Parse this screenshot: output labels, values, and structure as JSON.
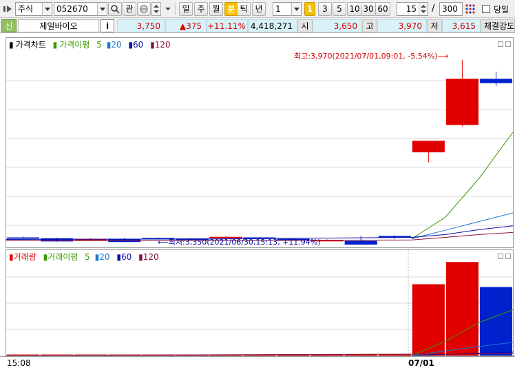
{
  "toolbar": {
    "market_type": "주식",
    "stock_code": "052670",
    "watch_label": "관",
    "period_tabs": [
      "일",
      "주",
      "월",
      "분",
      "틱",
      "년"
    ],
    "active_period": "분",
    "interval_value": "1",
    "quick_intervals": [
      "1",
      "3",
      "5",
      "10",
      "30",
      "60"
    ],
    "active_quick_interval": "1",
    "display_count": "15",
    "separator": "/",
    "total_count": "300",
    "same_day_label": "당일"
  },
  "quote": {
    "market_badge": "신",
    "stock_name": "제일바이오",
    "info_label": "i",
    "price": "3,750",
    "change": "▲375",
    "change_rate": "+11.11%",
    "volume": "4,418,271",
    "open_label": "시",
    "open": "3,650",
    "high_label": "고",
    "high": "3,970",
    "low_label": "저",
    "low": "3,615",
    "exec_label": "체결강도"
  },
  "price_panel": {
    "legend": {
      "main": "가격차트",
      "ma_title": "가격이평",
      "ma_periods": [
        "5",
        "20",
        "60",
        "120"
      ]
    },
    "high_annotation": "최고:3,970(2021/07/01,09:01, -5.54%)⟶",
    "low_annotation": "⟵최저:3,350(2021/06/30,15:13, +11.94%)"
  },
  "volume_panel": {
    "legend": {
      "main": "거래량",
      "ma_title": "거래이평",
      "ma_periods": [
        "5",
        "20",
        "60",
        "120"
      ]
    }
  },
  "footer": {
    "time_label": "15:08",
    "date_label": "07/01"
  },
  "colors": {
    "up": "#e00000",
    "down": "#0022cc",
    "ma5": "#3a9a00",
    "ma20": "#1878d0",
    "ma60": "#0a0aa8",
    "ma120": "#8a1040",
    "grid": "#d9d9d9"
  },
  "chart_data": [
    {
      "type": "candlestick",
      "title": "가격차트",
      "series_colors": {
        "up": "#e00000",
        "down": "#0022cc"
      },
      "candles": [
        {
          "o": 3355,
          "h": 3358,
          "l": 3350,
          "c": 3352
        },
        {
          "o": 3352,
          "h": 3354,
          "l": 3340,
          "c": 3341
        },
        {
          "o": 3350,
          "h": 3352,
          "l": 3345,
          "c": 3350
        },
        {
          "o": 3350,
          "h": 3354,
          "l": 3338,
          "c": 3339
        },
        {
          "o": 3353,
          "h": 3355,
          "l": 3348,
          "c": 3351
        },
        {
          "o": 3351,
          "h": 3353,
          "l": 3346,
          "c": 3350
        },
        {
          "o": 3354,
          "h": 3358,
          "l": 3350,
          "c": 3357
        },
        {
          "o": 3355,
          "h": 3357,
          "l": 3348,
          "c": 3350
        },
        {
          "o": 3350,
          "h": 3352,
          "l": 3345,
          "c": 3348
        },
        {
          "o": 3345,
          "h": 3348,
          "l": 3342,
          "c": 3346
        },
        {
          "o": 3343,
          "h": 3360,
          "l": 3330,
          "c": 3330
        },
        {
          "o": 3360,
          "h": 3362,
          "l": 3350,
          "c": 3355
        },
        {
          "o": 3650,
          "h": 3650,
          "l": 3615,
          "c": 3690
        },
        {
          "o": 3745,
          "h": 3970,
          "l": 3740,
          "c": 3905
        },
        {
          "o": 3905,
          "h": 3930,
          "l": 3880,
          "c": 3890
        }
      ],
      "moving_averages": [
        {
          "name": "5",
          "color": "#3a9a00",
          "points": [
            [
              11.5,
              3350
            ],
            [
              12.5,
              3425
            ],
            [
              13.5,
              3560
            ],
            [
              14.5,
              3720
            ]
          ]
        },
        {
          "name": "20",
          "color": "#1878d0",
          "points": [
            [
              11.5,
              3350
            ],
            [
              12.5,
              3380
            ],
            [
              13.5,
              3410
            ],
            [
              14.5,
              3440
            ]
          ]
        },
        {
          "name": "60",
          "color": "#0a0aa8",
          "points": [
            [
              -0.5,
              3348
            ],
            [
              6,
              3350
            ],
            [
              11.5,
              3355
            ],
            [
              12.5,
              3365
            ],
            [
              13.5,
              3382
            ],
            [
              14.5,
              3395
            ]
          ]
        },
        {
          "name": "120",
          "color": "#8a1040",
          "points": [
            [
              -0.5,
              3343
            ],
            [
              6,
              3344
            ],
            [
              11.5,
              3346
            ],
            [
              12.5,
              3355
            ],
            [
              13.5,
              3365
            ],
            [
              14.5,
              3372
            ]
          ]
        }
      ],
      "ylim": [
        3330,
        3980
      ]
    },
    {
      "type": "bar",
      "title": "거래량",
      "values": [
        2000,
        1500,
        2500,
        1800,
        4000,
        1800,
        1200,
        1500,
        2200,
        1800,
        2000,
        6000,
        1250000,
        1640000,
        1200000
      ],
      "bar_colors": [
        "#e00000",
        "#e00000",
        "#e00000",
        "#e00000",
        "#e00000",
        "#e00000",
        "#e00000",
        "#e00000",
        "#e00000",
        "#e00000",
        "#e00000",
        "#e00000",
        "#e00000",
        "#e00000",
        "#0022cc"
      ],
      "moving_averages": [
        {
          "name": "5",
          "color": "#3a9a00",
          "points": [
            [
              11.5,
              2000
            ],
            [
              12.5,
              250000
            ],
            [
              13.5,
              580000
            ],
            [
              14.5,
              800000
            ]
          ]
        },
        {
          "name": "20",
          "color": "#1878d0",
          "points": [
            [
              11.5,
              2000
            ],
            [
              12.5,
              80000
            ],
            [
              13.5,
              160000
            ],
            [
              14.5,
              230000
            ]
          ]
        },
        {
          "name": "60",
          "color": "#0a0aa8",
          "points": [
            [
              11.5,
              2000
            ],
            [
              14.5,
              60000
            ]
          ]
        },
        {
          "name": "120",
          "color": "#8a1040",
          "points": [
            [
              -0.5,
              1500
            ],
            [
              14.5,
              30000
            ]
          ]
        }
      ],
      "ylim": [
        0,
        1800000
      ]
    }
  ]
}
